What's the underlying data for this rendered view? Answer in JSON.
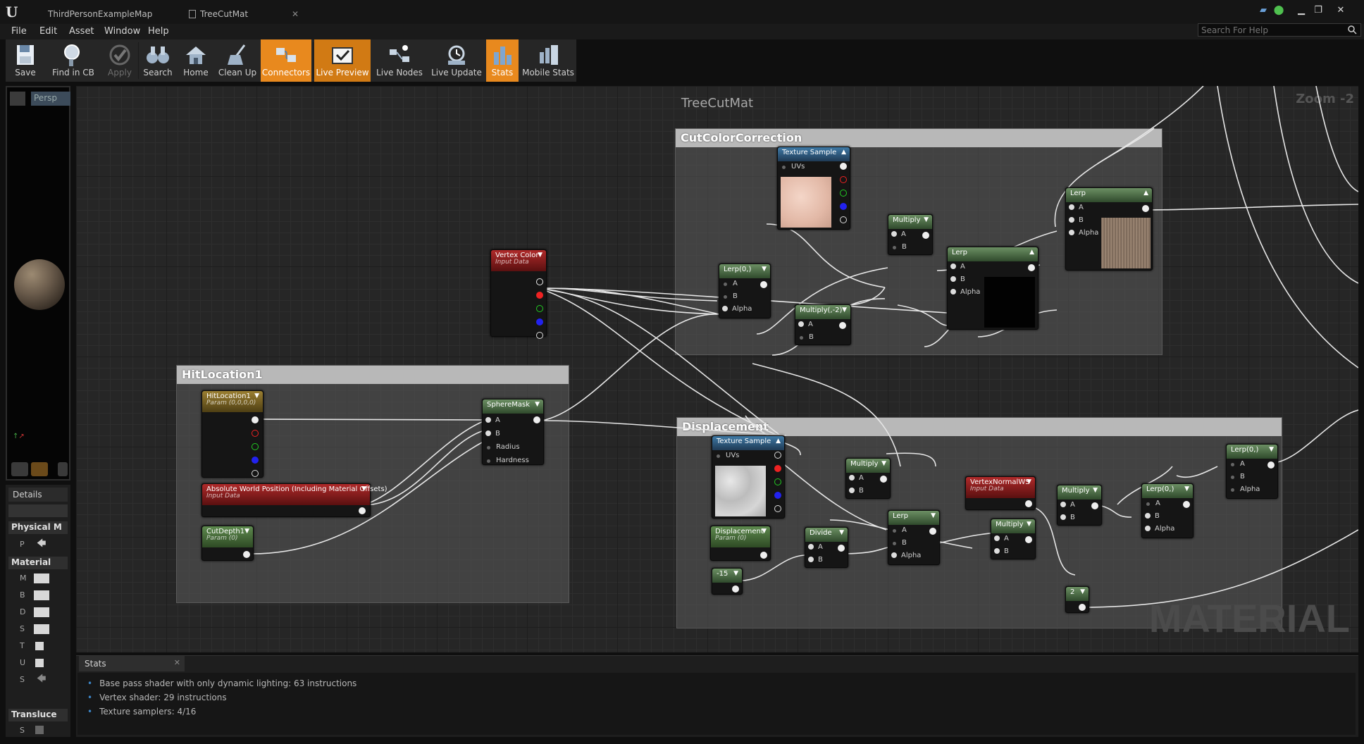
{
  "tabs": [
    {
      "label": "ThirdPersonExampleMap",
      "active": false
    },
    {
      "label": "TreeCutMat",
      "active": true
    }
  ],
  "menu": [
    "File",
    "Edit",
    "Asset",
    "Window",
    "Help"
  ],
  "help_search": {
    "placeholder": "Search For Help"
  },
  "toolbar": [
    {
      "label": "Save",
      "icon": "save-icon",
      "state": "normal"
    },
    {
      "label": "Find in CB",
      "icon": "find-icon",
      "state": "normal"
    },
    {
      "label": "Apply",
      "icon": "checkmark-icon",
      "state": "disabled"
    },
    {
      "label": "Search",
      "icon": "binoculars-icon",
      "state": "normal"
    },
    {
      "label": "Home",
      "icon": "home-icon",
      "state": "normal"
    },
    {
      "label": "Clean Up",
      "icon": "broom-icon",
      "state": "normal"
    },
    {
      "label": "Connectors",
      "icon": "connectors-icon",
      "state": "on"
    },
    {
      "label": "Live Preview",
      "icon": "live-preview-icon",
      "state": "on"
    },
    {
      "label": "Live Nodes",
      "icon": "live-nodes-icon",
      "state": "normal"
    },
    {
      "label": "Live Update",
      "icon": "live-update-icon",
      "state": "normal"
    },
    {
      "label": "Stats",
      "icon": "stats-icon",
      "state": "on"
    },
    {
      "label": "Mobile Stats",
      "icon": "mobile-stats-icon",
      "state": "normal"
    }
  ],
  "preview": {
    "view_label": "Persp"
  },
  "details": {
    "tab": "Details",
    "sections": {
      "physical": "Physical M",
      "material": "Material",
      "translucency": "Transluce"
    },
    "rows": {
      "p": "P",
      "m": "M",
      "b": "B",
      "d": "D",
      "s": "S",
      "t": "T",
      "u": "U",
      "s2": "S",
      "s3": "S"
    }
  },
  "graph": {
    "title": "TreeCutMat",
    "zoom": "Zoom -2",
    "watermark": "MATERIAL",
    "comments": {
      "cut_color": "CutColorCorrection",
      "hit_location": "HitLocation1",
      "displacement": "Displacement"
    },
    "nodes": {
      "vertex_color": {
        "title": "Vertex Color",
        "sub": "Input Data"
      },
      "hitloc_param": {
        "title": "HitLocation1",
        "sub": "Param (0,0,0,0)"
      },
      "sphere_mask": {
        "title": "SphereMask",
        "pins": [
          "A",
          "B",
          "Radius",
          "Hardness"
        ]
      },
      "abs_world_pos": {
        "title": "Absolute World Position (Including Material Offsets)",
        "sub": "Input Data"
      },
      "cut_depth": {
        "title": "CutDepth1",
        "sub": "Param (0)"
      },
      "tex_sample_top": {
        "title": "Texture Sample",
        "pin": "UVs"
      },
      "multiply_top": {
        "title": "Multiply",
        "pins": [
          "A",
          "B"
        ]
      },
      "lerp_final": {
        "title": "Lerp",
        "pins": [
          "A",
          "B",
          "Alpha"
        ]
      },
      "lerp_mid": {
        "title": "Lerp",
        "pins": [
          "A",
          "B",
          "Alpha"
        ]
      },
      "lerp_0": {
        "title": "Lerp(0,)",
        "pins": [
          "A",
          "B",
          "Alpha"
        ]
      },
      "multiply_neg2": {
        "title": "Multiply(,-2)",
        "pins": [
          "A",
          "B"
        ]
      },
      "tex_sample_disp": {
        "title": "Texture Sample",
        "pin": "UVs"
      },
      "multiply_disp": {
        "title": "Multiply",
        "pins": [
          "A",
          "B"
        ]
      },
      "vertex_normal": {
        "title": "VertexNormalWS",
        "sub": "Input Data"
      },
      "multiply_d2": {
        "title": "Multiply",
        "pins": [
          "A",
          "B"
        ]
      },
      "lerp_d1": {
        "title": "Lerp(0,)",
        "pins": [
          "A",
          "B",
          "Alpha"
        ]
      },
      "lerp_d2": {
        "title": "Lerp(0,)",
        "pins": [
          "A",
          "B",
          "Alpha"
        ]
      },
      "disp_param": {
        "title": "Displacement",
        "sub": "Param (0)"
      },
      "divide": {
        "title": "Divide",
        "pins": [
          "A",
          "B"
        ]
      },
      "lerp_disp": {
        "title": "Lerp",
        "pins": [
          "A",
          "B",
          "Alpha"
        ]
      },
      "multiply_d3": {
        "title": "Multiply",
        "pins": [
          "A",
          "B"
        ]
      },
      "const_neg15": {
        "title": "-15"
      },
      "const_2": {
        "title": "2"
      }
    }
  },
  "stats": {
    "tab": "Stats",
    "lines": [
      "Base pass shader with only dynamic lighting: 63 instructions",
      "Vertex shader: 29 instructions",
      "Texture samplers: 4/16"
    ]
  }
}
